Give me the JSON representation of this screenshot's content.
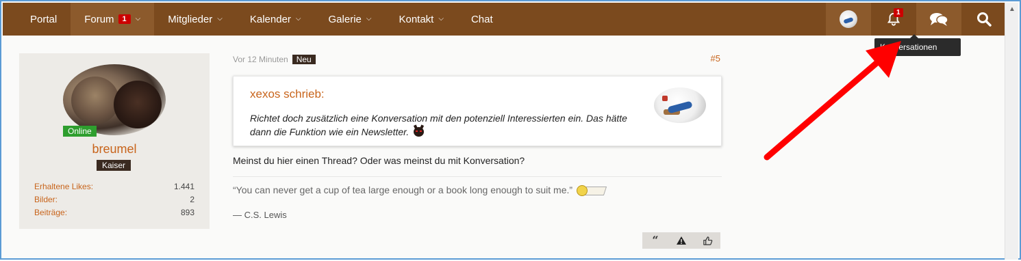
{
  "nav": {
    "items": [
      {
        "label": "Portal",
        "has_chevron": false
      },
      {
        "label": "Forum",
        "badge": "1",
        "has_chevron": true
      },
      {
        "label": "Mitglieder",
        "has_chevron": true
      },
      {
        "label": "Kalender",
        "has_chevron": true
      },
      {
        "label": "Galerie",
        "has_chevron": true
      },
      {
        "label": "Kontakt",
        "has_chevron": true
      },
      {
        "label": "Chat",
        "has_chevron": false
      }
    ],
    "notification_count": "1",
    "colors": {
      "navbar": "#7b4a1e",
      "navbar_active": "#8c5a2c",
      "badge": "#cc0000"
    }
  },
  "tooltip": {
    "text": "Konversationen"
  },
  "sidebar": {
    "status": "Online",
    "username": "breumel",
    "rank": "Kaiser",
    "stats": [
      {
        "label": "Erhaltene Likes:",
        "value": "1.441"
      },
      {
        "label": "Bilder:",
        "value": "2"
      },
      {
        "label": "Beiträge:",
        "value": "893"
      }
    ]
  },
  "post": {
    "time": "Vor 12 Minuten",
    "new_label": "Neu",
    "number": "#5",
    "quote": {
      "author": "xexos schrieb:",
      "text": "Richtet doch zusätzlich eine Konversation mit den potenziell Interessierten ein. Das hätte dann die Funktion wie ein Newsletter."
    },
    "body": "Meinst du hier einen Thread? Oder was meinst du mit Konversation?",
    "signature": {
      "quote": "“You can never get a cup of tea large enough or a book long enough to suit me.”",
      "author": "— C.S. Lewis"
    }
  },
  "colors": {
    "accent": "#c8641b",
    "online": "#2e9e2e",
    "arrow": "#ff0000"
  }
}
